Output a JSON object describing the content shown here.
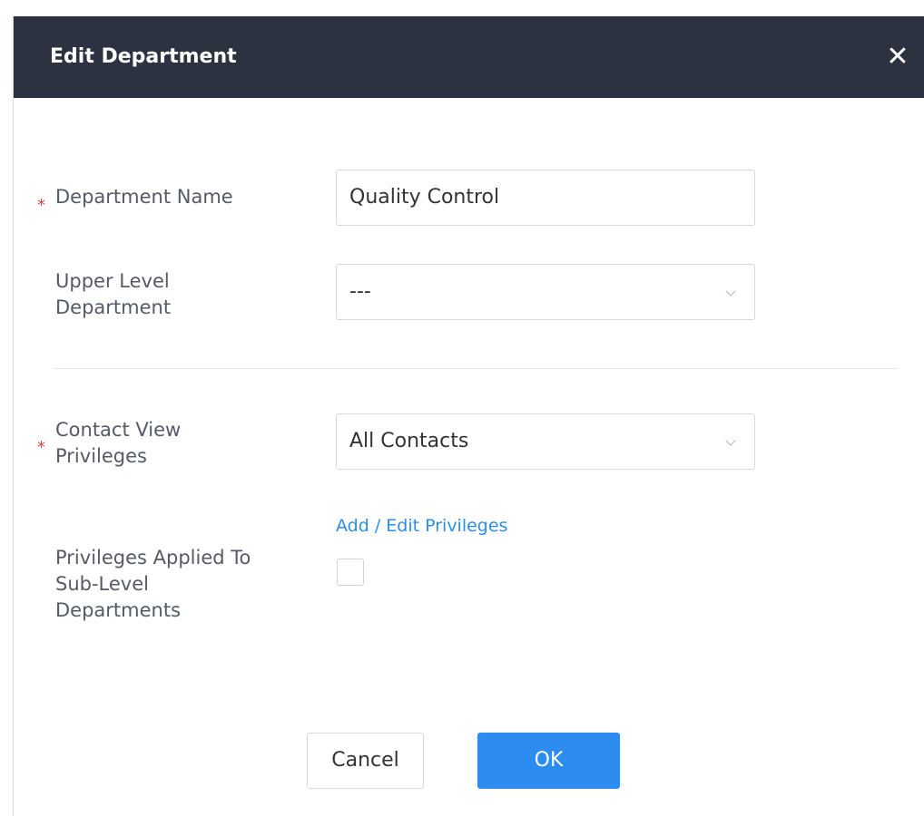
{
  "dialog": {
    "title": "Edit Department",
    "close_glyph": "✕"
  },
  "form": {
    "department_name": {
      "required_mark": "*",
      "label": "Department Name",
      "value": "Quality Control"
    },
    "upper_level_department": {
      "label_line1": "Upper Level",
      "label_line2": "Department",
      "value": "---"
    },
    "contact_view_privileges": {
      "required_mark": "*",
      "label_line1": "Contact View",
      "label_line2": "Privileges",
      "value": "All Contacts"
    },
    "add_edit_privileges_link": "Add / Edit Privileges",
    "privileges_applied": {
      "label_line1": "Privileges Applied To",
      "label_line2": "Sub-Level",
      "label_line3": "Departments",
      "checked": false
    }
  },
  "footer": {
    "cancel_label": "Cancel",
    "ok_label": "OK"
  },
  "colors": {
    "header_bg": "#2d3240",
    "primary": "#2d8cf0",
    "link": "#2c8ee8",
    "required": "#e8433f"
  },
  "icons": [
    "close-icon",
    "chevron-down-icon"
  ]
}
